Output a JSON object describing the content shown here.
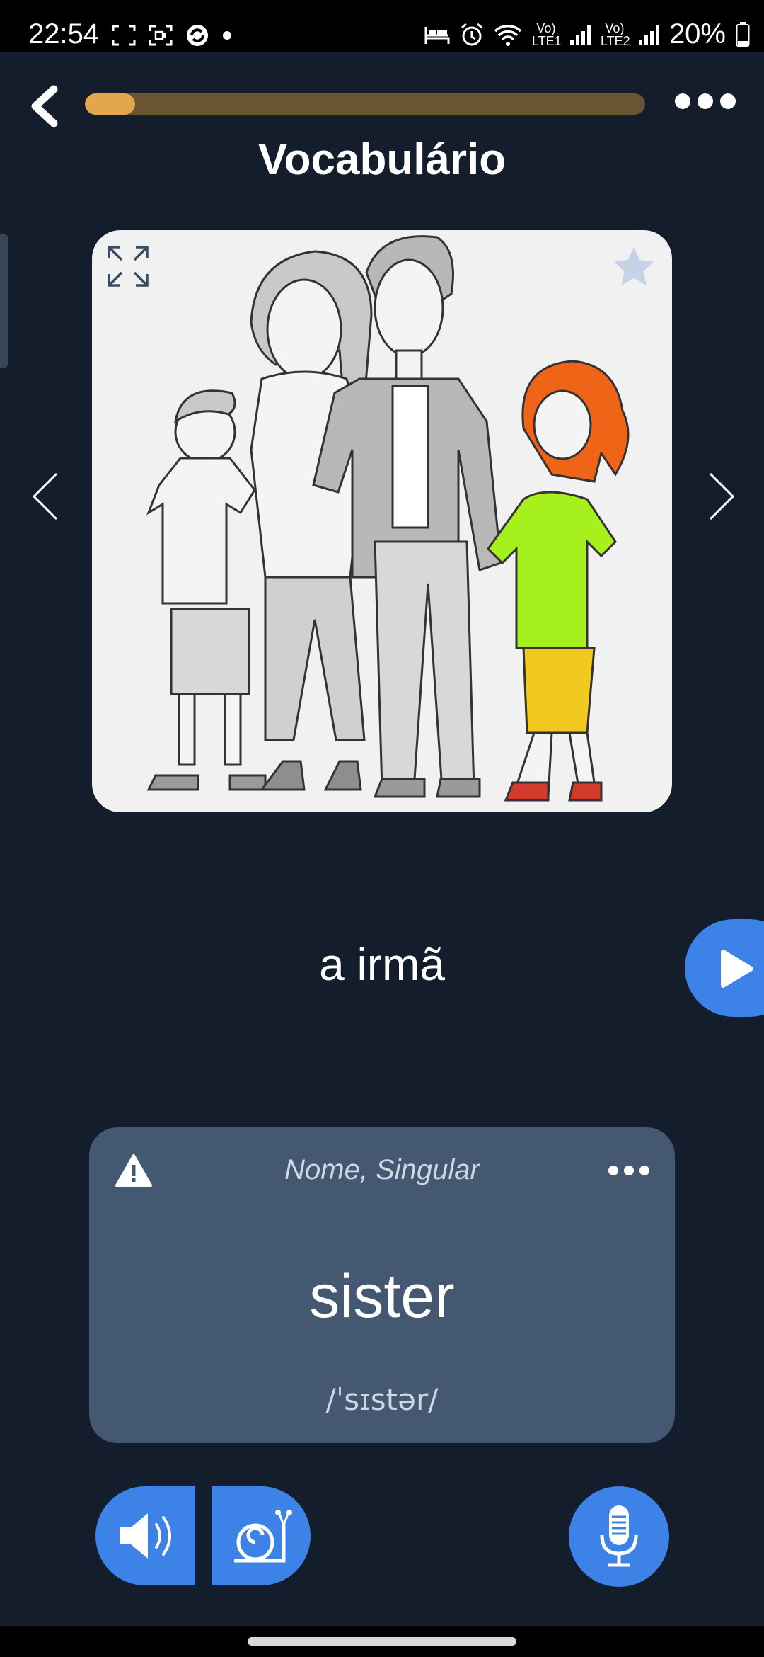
{
  "status_bar": {
    "time": "22:54",
    "network1": "Vo) LTE1",
    "network2": "Vo) LTE2",
    "battery": "20%"
  },
  "header": {
    "progress_fraction": 0.09,
    "title": "Vocabulário"
  },
  "card": {
    "word": "a irmã",
    "part_of_speech": "Nome, Singular",
    "translation": "sister",
    "pronunciation": "/ˈsɪstər/"
  },
  "colors": {
    "background": "#141d2b",
    "accent_blue": "#3d82e6",
    "progress_fill": "#e1a64e",
    "progress_track": "#6a5434",
    "card_bg": "#445872"
  }
}
